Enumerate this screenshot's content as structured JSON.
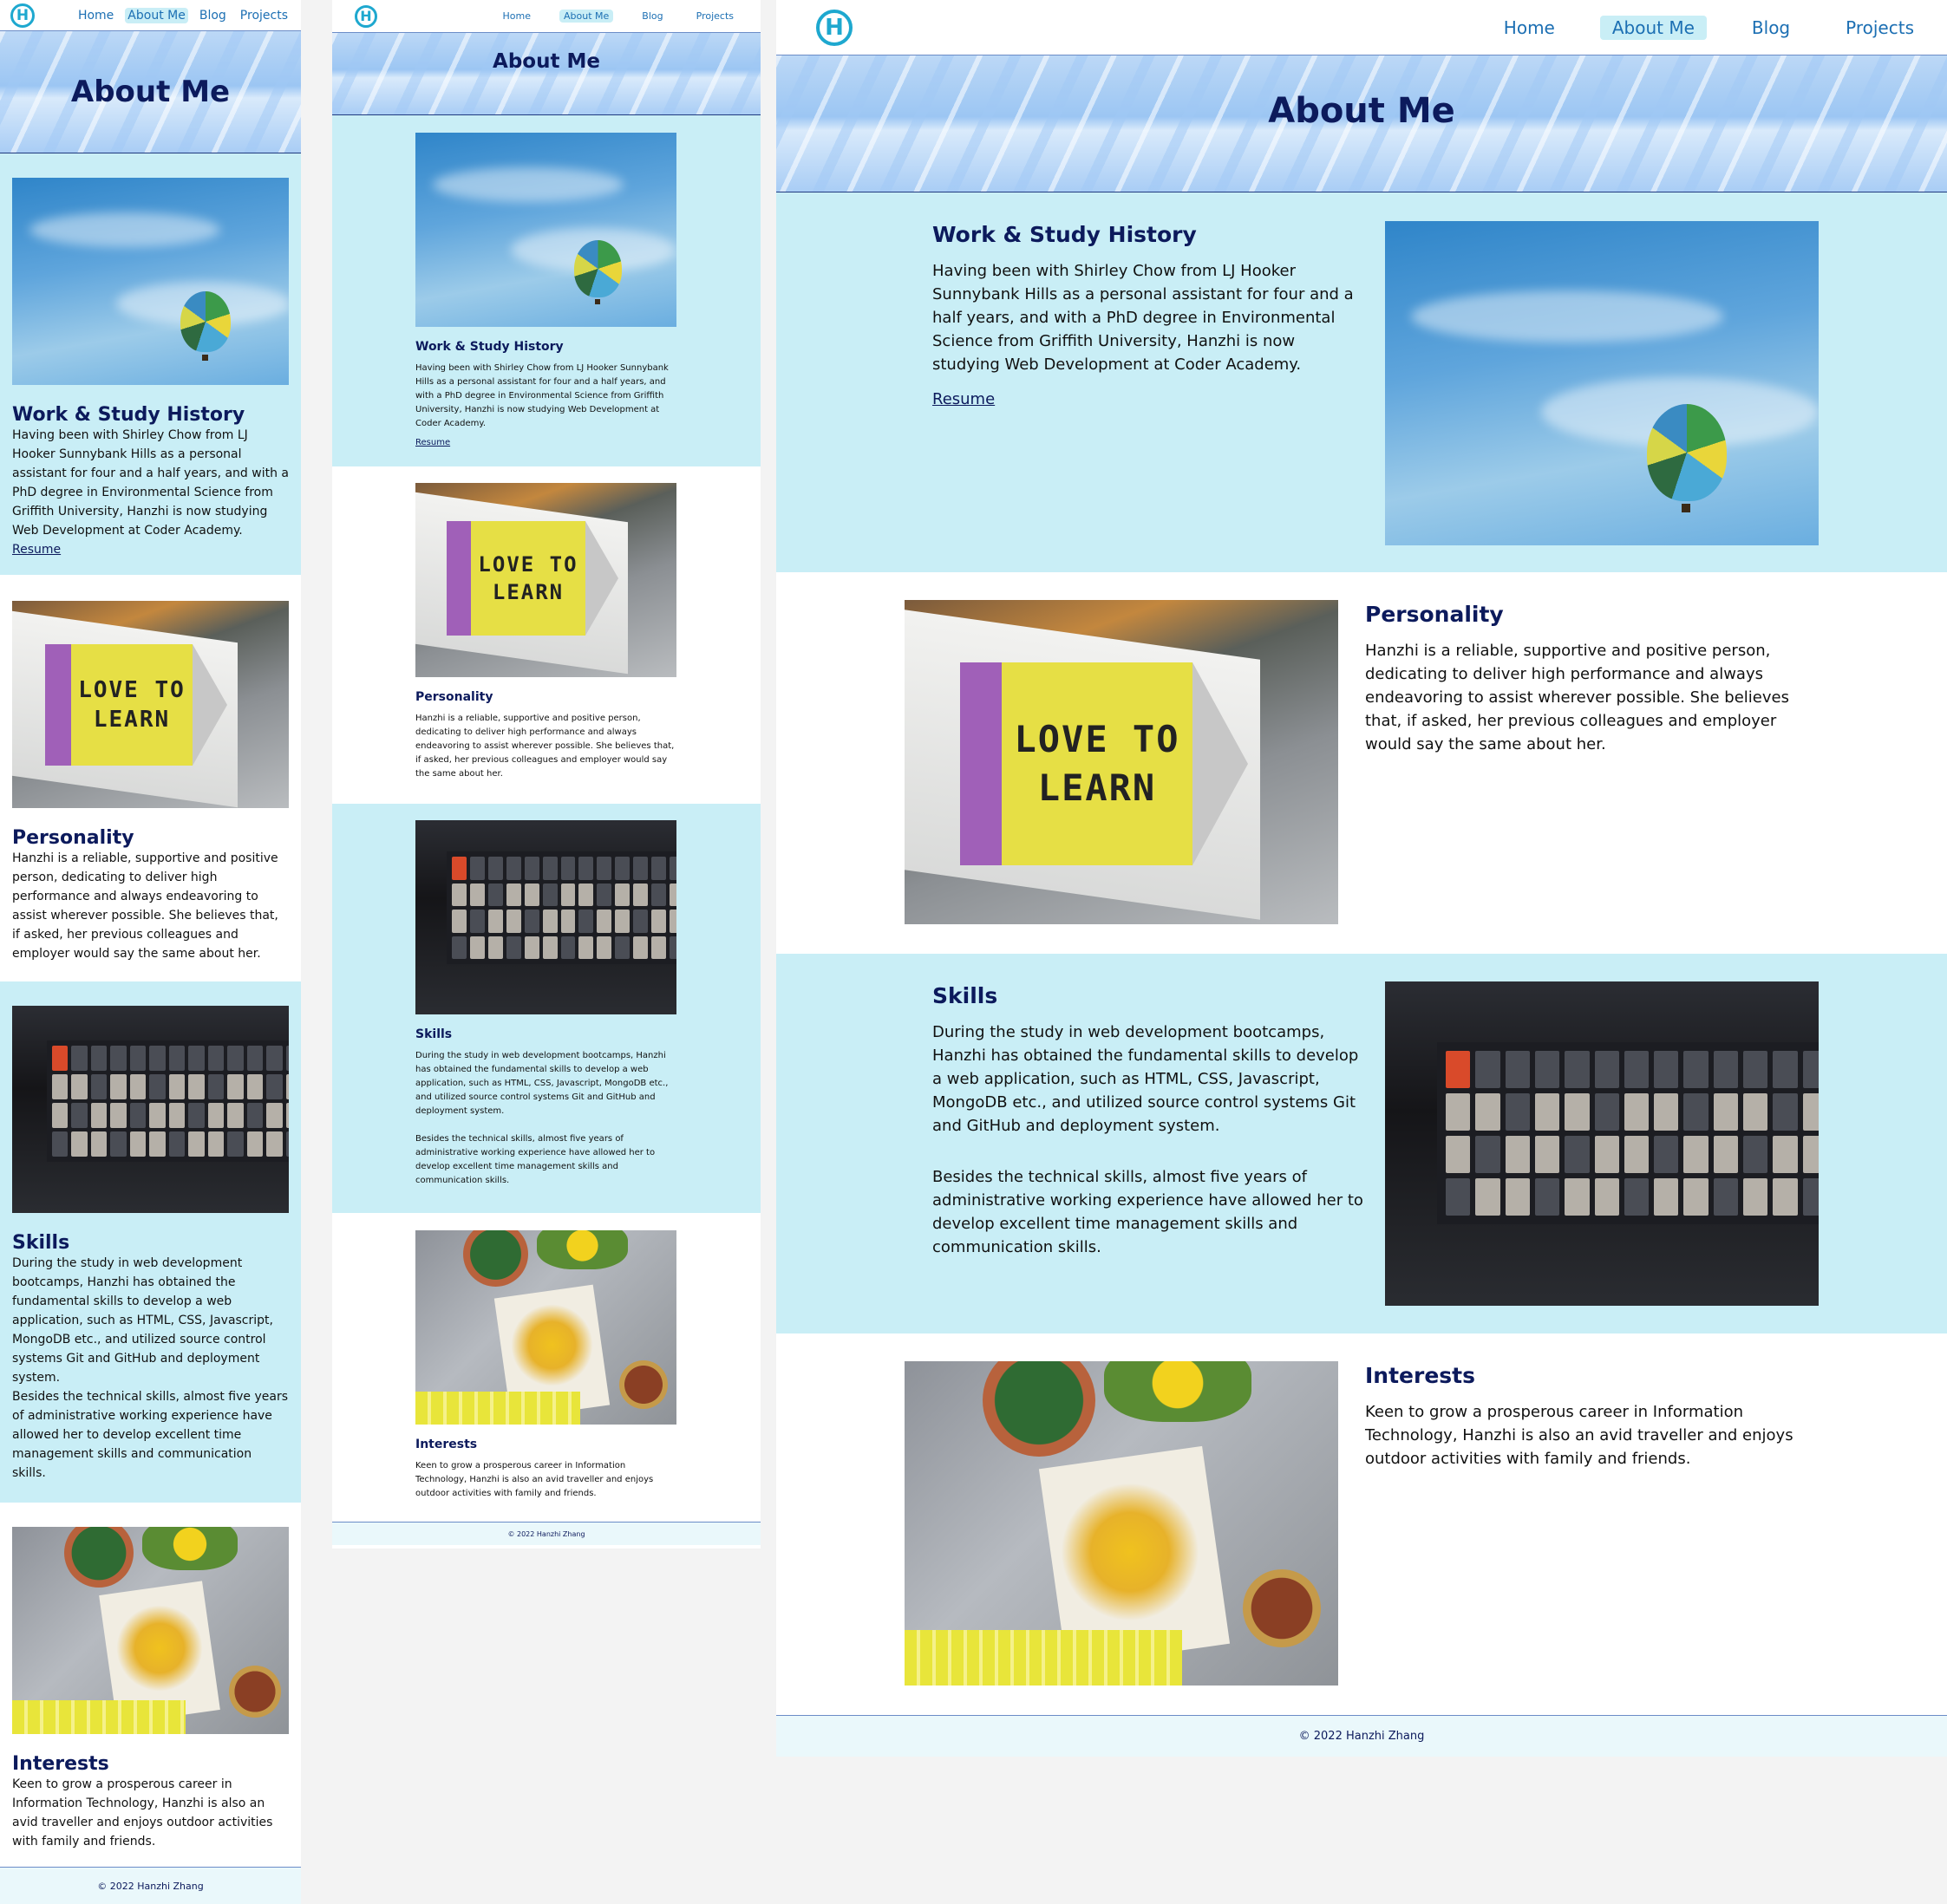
{
  "site": {
    "logo_letter": "H",
    "nav": [
      "Home",
      "About Me",
      "Blog",
      "Projects"
    ],
    "active_nav": "About Me"
  },
  "hero": {
    "title": "About Me"
  },
  "sections": [
    {
      "title": "Work & Study History",
      "paragraphs": [
        "Having been with Shirley Chow from LJ Hooker Sunnybank Hills as a personal assistant for four and a half years, and with a PhD degree in Environmental Science from Griffith University, Hanzhi is now studying Web Development at Coder Academy."
      ],
      "link": "Resume",
      "image": "hot-air-balloon-photo",
      "background": "blue"
    },
    {
      "title": "Personality",
      "paragraphs": [
        "Hanzhi is a reliable, supportive and positive person, dedicating to deliver high performance and always endeavoring to assist wherever possible. She believes that, if asked, her previous colleagues and employer would say the same about her."
      ],
      "image": "love-to-learn-pencil-photo",
      "background": "white"
    },
    {
      "title": "Skills",
      "paragraphs": [
        "During the study in web development bootcamps, Hanzhi has obtained the fundamental skills to develop a web application, such as HTML, CSS, Javascript, MongoDB etc., and utilized source control systems Git and GitHub and deployment system.",
        "Besides the technical skills, almost five years of administrative working experience have allowed her to develop excellent time management skills and communication skills."
      ],
      "image": "keyboard-photo",
      "background": "blue"
    },
    {
      "title": "Interests",
      "paragraphs": [
        "Keen to grow a prosperous career in Information Technology, Hanzhi is also an avid traveller and enjoys outdoor activities with family and friends."
      ],
      "image": "watercolor-painting-photo",
      "background": "white"
    }
  ],
  "image_text": {
    "pencil_line1": "LOVE TO",
    "pencil_line2": "LEARN"
  },
  "footer": {
    "text": "© 2022 Hanzhi Zhang"
  },
  "colors": {
    "accent": "#1ea8cf",
    "heading": "#0c1a5c",
    "section_blue": "#c9eef6",
    "nav_link": "#1c6fb3"
  }
}
